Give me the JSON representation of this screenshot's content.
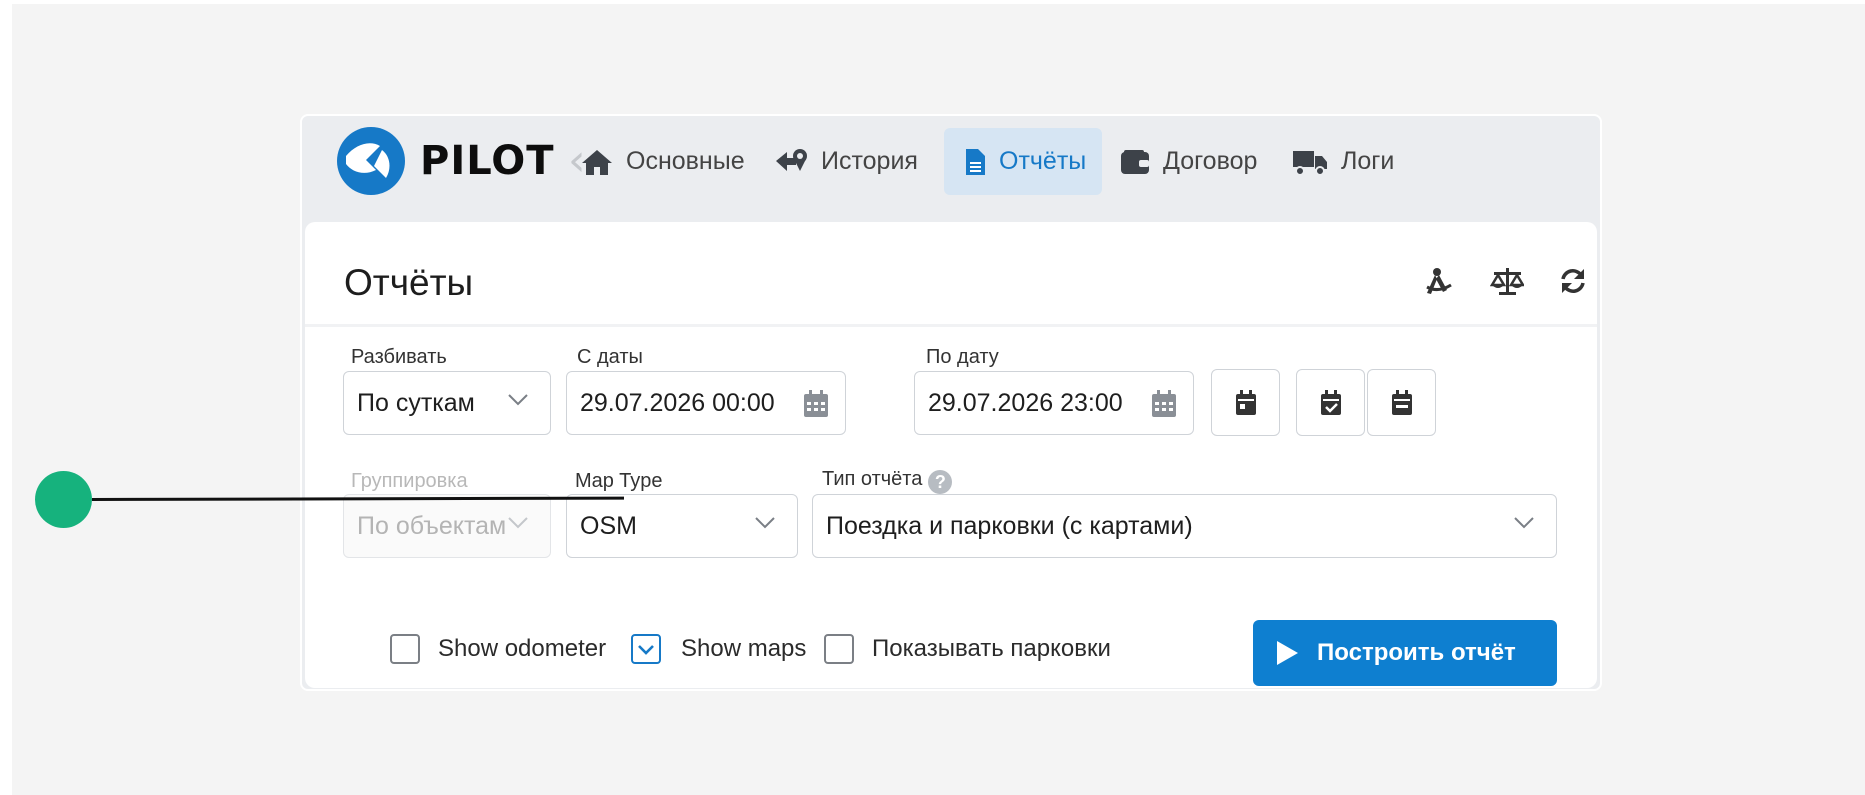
{
  "app": {
    "logo_text": "PILOT",
    "brand_color": "#1679c7",
    "nav": {
      "back_icon": "chevron-left-icon",
      "items": [
        {
          "label": "Основные",
          "icon": "home-icon",
          "active": false
        },
        {
          "label": "История",
          "icon": "history-icon",
          "active": false
        },
        {
          "label": "Отчёты",
          "icon": "file-text-icon",
          "active": true
        },
        {
          "label": "Договор",
          "icon": "wallet-icon",
          "active": false
        },
        {
          "label": "Логи",
          "icon": "truck-icon",
          "active": false
        }
      ]
    }
  },
  "card": {
    "title": "Отчёты",
    "tools": [
      {
        "icon": "compass-icon"
      },
      {
        "icon": "scales-icon"
      },
      {
        "icon": "refresh-icon"
      }
    ]
  },
  "form": {
    "split": {
      "label": "Разбивать",
      "value": "По суткам"
    },
    "date_from": {
      "label": "С даты",
      "value": "29.07.2026 00:00"
    },
    "date_to": {
      "label": "По дату",
      "value": "29.07.2026 23:00"
    },
    "quick_dates": [
      {
        "icon": "calendar-day-icon"
      },
      {
        "icon": "calendar-check-icon"
      },
      {
        "icon": "calendar-minus-icon"
      }
    ],
    "grouping": {
      "label": "Группировка",
      "value": "По объектам",
      "disabled": true
    },
    "map_type": {
      "label": "Map Type",
      "value": "OSM"
    },
    "report_type": {
      "label": "Тип отчёта",
      "help": "?",
      "value": "Поездка и парковки (с картами)"
    },
    "options": [
      {
        "label": "Show odometer",
        "checked": false
      },
      {
        "label": "Show maps",
        "checked": true
      },
      {
        "label": "Показывать парковки",
        "checked": false
      }
    ],
    "build_button": "Построить отчёт"
  },
  "annotation": {
    "marker_color": "#16b27d"
  }
}
